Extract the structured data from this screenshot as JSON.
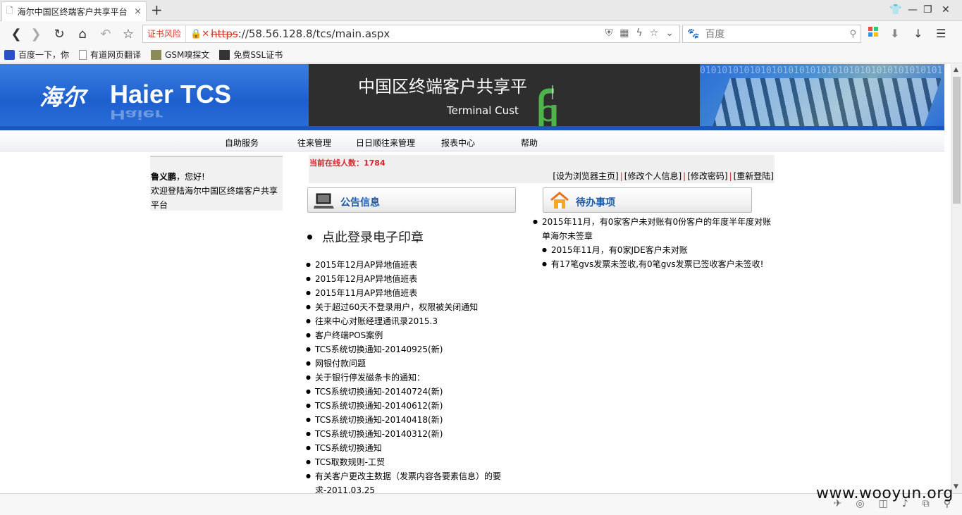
{
  "browser": {
    "tab_title": "海尔中国区终端客户共享平台",
    "tab_close": "×",
    "new_tab": "+",
    "cert_risk": "证书风险",
    "url_scheme": "https",
    "url_rest": "://58.56.128.8/tcs/main.aspx",
    "search_placeholder": "百度",
    "bookmarks": [
      "百度一下，你",
      "有道网页翻译",
      "GSM嗅探文",
      "免费SSL证书"
    ]
  },
  "banner": {
    "logo_cn": "海尔",
    "logo_en": "Haier TCS",
    "title": "中国区终端客户共享平",
    "subtitle": "Terminal Cust",
    "binary": "01010101010101010101010101010101010101010101"
  },
  "menu": [
    "自助服务",
    "往来管理",
    "日日顺往来管理",
    "报表中心",
    "帮助"
  ],
  "user": {
    "name": "鲁义鹏",
    "greeting": "，您好!",
    "welcome": "欢迎登陆海尔中国区终端客户共享平台"
  },
  "status": {
    "online_label": "当前在线人数：",
    "online_count": "1784",
    "links": [
      "[设为浏览器主页]",
      "[修改个人信息]",
      "[修改密码]",
      "[重新登陆]"
    ]
  },
  "notice": {
    "title": "公告信息",
    "seal_link": "点此登录电子印章",
    "items": [
      "2015年12月AP异地值班表",
      "2015年12月AP异地值班表",
      "2015年11月AP异地值班表",
      "关于超过60天不登录用户，权限被关闭通知",
      "往来中心对账经理通讯录2015.3",
      "客户终端POS案例",
      "TCS系统切换通知-20140925(新)",
      "网银付款问题",
      "关于银行停发磁条卡的通知：",
      "TCS系统切换通知-20140724(新)",
      "TCS系统切换通知-20140612(新)",
      "TCS系统切换通知-20140418(新)",
      "TCS系统切换通知-20140312(新)",
      "TCS系统切换通知",
      "TCS取数规则-工贸",
      "有关客户更改主数据（发票内容各要素信息）的要求-2011.03.25"
    ]
  },
  "todo": {
    "title": "待办事项",
    "items": [
      "2015年11月，有0家客户未对账有0份客户的年度半年度对账单海尔未签章",
      "2015年11月，有0家JDE客户未对账",
      "有17笔gvs发票未签收,有0笔gvs发票已签收客户未签收!"
    ]
  },
  "watermark": "www.wooyun.org",
  "colors": {
    "accent_red": "#d6262e",
    "link_blue": "#1c5aa8",
    "banner_blue": "#1e5fce"
  }
}
